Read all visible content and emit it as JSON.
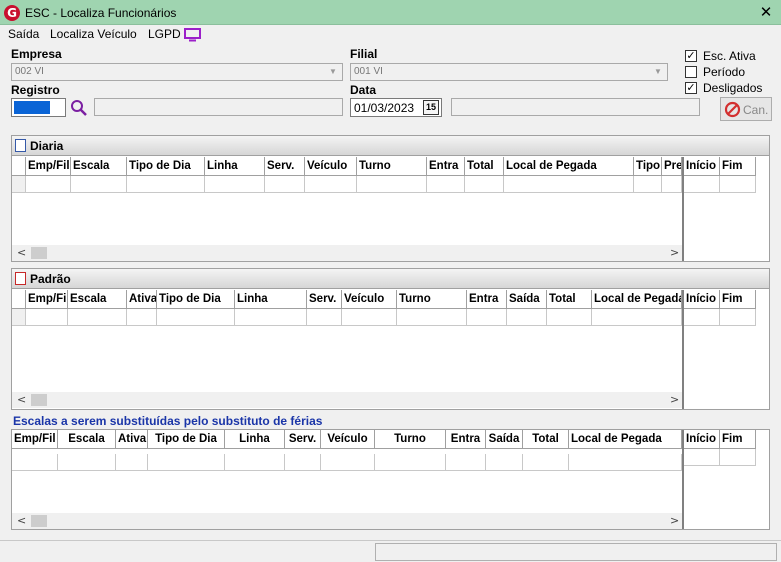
{
  "window": {
    "title": "ESC - Localiza Funcionários",
    "close": "✕",
    "logo": "G"
  },
  "menu": {
    "saida": "Saída",
    "localiza": "Localiza Veículo",
    "lgpd": "LGPD"
  },
  "form": {
    "empresa_label": "Empresa",
    "empresa_value": "002 VI",
    "filial_label": "Filial",
    "filial_value": "001 VI",
    "registro_label": "Registro",
    "data_label": "Data",
    "data_value": "01/03/2023",
    "calendar": "15"
  },
  "checks": [
    {
      "label": "Esc. Ativa",
      "checked": true
    },
    {
      "label": "Período",
      "checked": false
    },
    {
      "label": "Desligados",
      "checked": true
    }
  ],
  "can_button": "Can.",
  "diaria": {
    "title": "Diaria",
    "columns": [
      "Emp/Fil",
      "Escala",
      "Tipo de Dia",
      "Linha",
      "Serv.",
      "Veículo",
      "Turno",
      "Entra",
      "Total",
      "Local de Pegada",
      "Tipo",
      "Pre"
    ],
    "right_columns": [
      "Início",
      "Fim"
    ]
  },
  "padrao": {
    "title": "Padrão",
    "columns": [
      "Emp/Fil",
      "Escala",
      "Ativa",
      "Tipo de Dia",
      "Linha",
      "Serv.",
      "Veículo",
      "Turno",
      "Entra",
      "Saída",
      "Total",
      "Local de Pegada"
    ],
    "right_columns": [
      "Início",
      "Fim"
    ]
  },
  "ferias": {
    "title": "Escalas a serem substituídas pelo substituto de férias",
    "columns": [
      "Emp/Fil",
      "Escala",
      "Ativa",
      "Tipo de Dia",
      "Linha",
      "Serv.",
      "Veículo",
      "Turno",
      "Entra",
      "Saída",
      "Total",
      "Local de Pegada"
    ],
    "right_columns": [
      "Início",
      "Fim"
    ]
  },
  "scroll": {
    "left": "<",
    "right": ">"
  }
}
